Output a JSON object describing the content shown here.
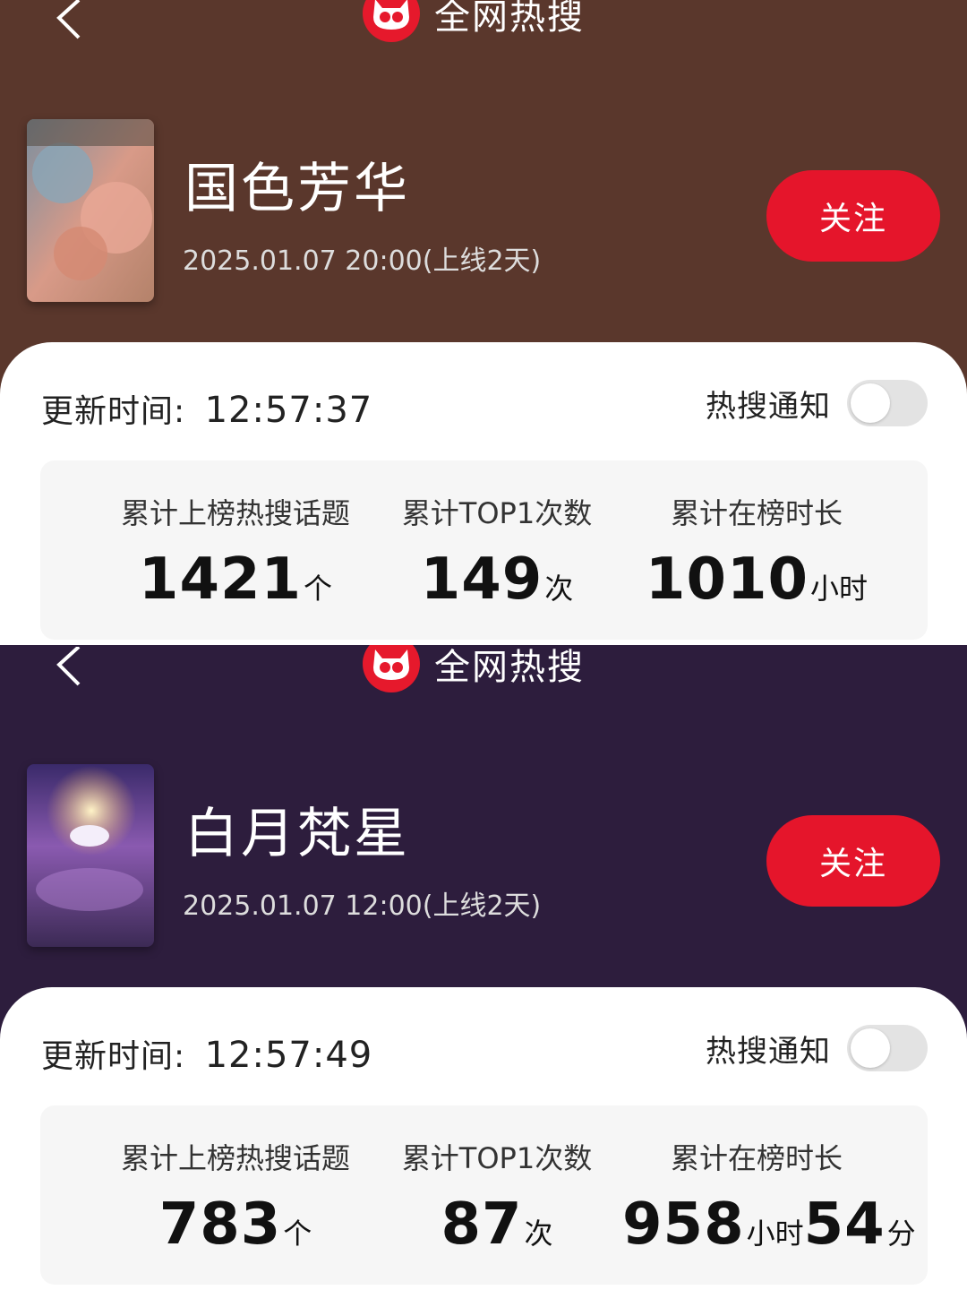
{
  "header": {
    "title": "全网热搜"
  },
  "colors": {
    "accent": "#e5152b",
    "panel1_bg": "#5a372c",
    "panel2_bg": "#2d1d3d"
  },
  "panels": [
    {
      "title": "国色芳华",
      "release": "2025.01.07 20:00(上线2天)",
      "follow_label": "关注",
      "update_label": "更新时间:",
      "update_time": "12:57:37",
      "notify_label": "热搜通知",
      "notify_on": false,
      "stats": [
        {
          "label": "累计上榜热搜话题",
          "value": "1421",
          "unit": "个"
        },
        {
          "label": "累计TOP1次数",
          "value": "149",
          "unit": "次"
        },
        {
          "label": "累计在榜时长",
          "value": "1010",
          "unit": "小时"
        }
      ]
    },
    {
      "title": "白月梵星",
      "release": "2025.01.07 12:00(上线2天)",
      "follow_label": "关注",
      "update_label": "更新时间:",
      "update_time": "12:57:49",
      "notify_label": "热搜通知",
      "notify_on": false,
      "stats": [
        {
          "label": "累计上榜热搜话题",
          "value": "783",
          "unit": "个"
        },
        {
          "label": "累计TOP1次数",
          "value": "87",
          "unit": "次"
        },
        {
          "label": "累计在榜时长",
          "value": "958",
          "unit": "小时",
          "value2": "54",
          "unit2": "分"
        }
      ]
    }
  ]
}
